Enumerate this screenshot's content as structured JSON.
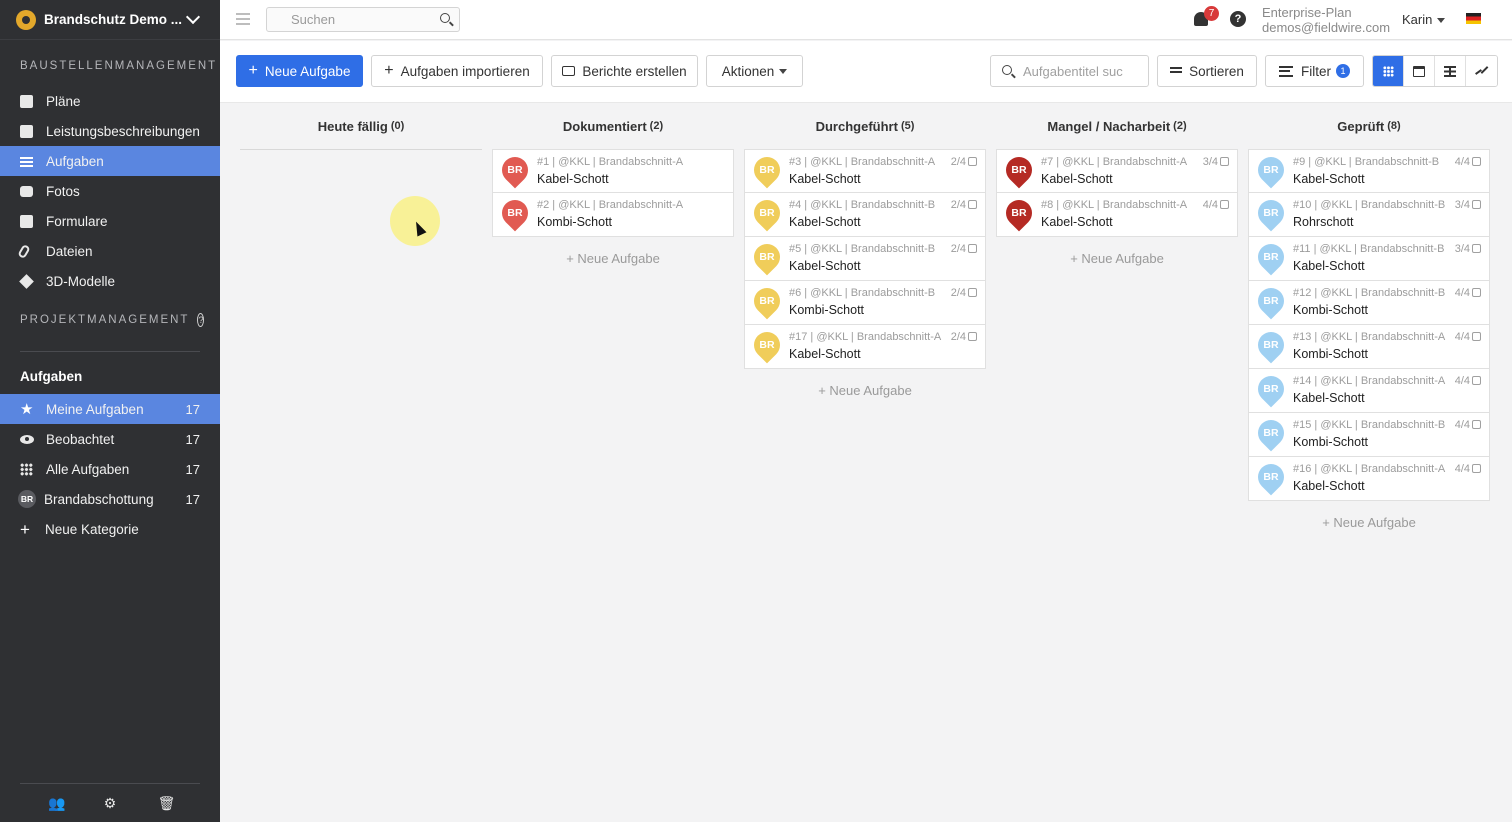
{
  "sidebar": {
    "project_name": "Brandschutz Demo ...",
    "section_site": "BAUSTELLENMANAGEMENT",
    "nav": [
      {
        "label": "Pläne",
        "icon": "plans-icon"
      },
      {
        "label": "Leistungsbeschreibungen",
        "icon": "specs-icon"
      },
      {
        "label": "Aufgaben",
        "icon": "tasks-list-icon",
        "active": true
      },
      {
        "label": "Fotos",
        "icon": "camera-icon"
      },
      {
        "label": "Formulare",
        "icon": "forms-icon"
      },
      {
        "label": "Dateien",
        "icon": "paperclip-icon"
      },
      {
        "label": "3D-Modelle",
        "icon": "cube-icon"
      }
    ],
    "section_project": "PROJEKTMANAGEMENT",
    "categories_title": "Aufgaben",
    "categories": [
      {
        "label": "Meine Aufgaben",
        "count": "17",
        "icon": "star-icon",
        "active": true
      },
      {
        "label": "Beobachtet",
        "count": "17",
        "icon": "eye-icon"
      },
      {
        "label": "Alle Aufgaben",
        "count": "17",
        "icon": "grid-icon"
      },
      {
        "label": "Brandabschottung",
        "count": "17",
        "icon": "category-badge-icon",
        "badge": "BR"
      },
      {
        "label": "Neue Kategorie",
        "count": "",
        "icon": "plus-icon"
      }
    ]
  },
  "topbar": {
    "search_placeholder": "Suchen",
    "notifications": "7",
    "plan": "Enterprise-Plan",
    "email": "demos@fieldwire.com",
    "user": "Karin"
  },
  "toolbar": {
    "new_task": "Neue Aufgabe",
    "import": "Aufgaben importieren",
    "reports": "Berichte erstellen",
    "actions": "Aktionen",
    "task_search_placeholder": "Aufgabentitel suc",
    "sort": "Sortieren",
    "filter": "Filter",
    "filter_count": "1"
  },
  "colors": {
    "accent": "#2f6ee6",
    "red": "#e15a52",
    "dark_red": "#b52a24",
    "yellow": "#f0cd5a",
    "light_blue": "#9fd0f2"
  },
  "board": {
    "new_task_label": "+ Neue Aufgabe",
    "columns": [
      {
        "title": "Heute fällig",
        "count": "(0)",
        "cards": []
      },
      {
        "title": "Dokumentiert",
        "count": "(2)",
        "cards": [
          {
            "meta": "#1 | @KKL | Brandabschnitt-A",
            "title": "Kabel-Schott",
            "check": "",
            "color": "#e15a52",
            "badge": "BR"
          },
          {
            "meta": "#2 | @KKL | Brandabschnitt-A",
            "title": "Kombi-Schott",
            "check": "",
            "color": "#e15a52",
            "badge": "BR"
          }
        ]
      },
      {
        "title": "Durchgeführt",
        "count": "(5)",
        "cards": [
          {
            "meta": "#3 | @KKL | Brandabschnitt-A",
            "title": "Kabel-Schott",
            "check": "2/4",
            "color": "#f0cd5a",
            "badge": "BR"
          },
          {
            "meta": "#4 | @KKL | Brandabschnitt-B",
            "title": "Kabel-Schott",
            "check": "2/4",
            "color": "#f0cd5a",
            "badge": "BR"
          },
          {
            "meta": "#5 | @KKL | Brandabschnitt-B",
            "title": "Kabel-Schott",
            "check": "2/4",
            "color": "#f0cd5a",
            "badge": "BR"
          },
          {
            "meta": "#6 | @KKL | Brandabschnitt-B",
            "title": "Kombi-Schott",
            "check": "2/4",
            "color": "#f0cd5a",
            "badge": "BR"
          },
          {
            "meta": "#17 | @KKL | Brandabschnitt-A",
            "title": "Kabel-Schott",
            "check": "2/4",
            "color": "#f0cd5a",
            "badge": "BR"
          }
        ]
      },
      {
        "title": "Mangel / Nacharbeit",
        "count": "(2)",
        "cards": [
          {
            "meta": "#7 | @KKL | Brandabschnitt-A",
            "title": "Kabel-Schott",
            "check": "3/4",
            "color": "#b52a24",
            "badge": "BR"
          },
          {
            "meta": "#8 | @KKL | Brandabschnitt-A",
            "title": "Kabel-Schott",
            "check": "4/4",
            "color": "#b52a24",
            "badge": "BR"
          }
        ]
      },
      {
        "title": "Geprüft",
        "count": "(8)",
        "cards": [
          {
            "meta": "#9 | @KKL | Brandabschnitt-B",
            "title": "Kabel-Schott",
            "check": "4/4",
            "color": "#9fd0f2",
            "badge": "BR"
          },
          {
            "meta": "#10 | @KKL | Brandabschnitt-B",
            "title": "Rohrschott",
            "check": "3/4",
            "color": "#9fd0f2",
            "badge": "BR"
          },
          {
            "meta": "#11 | @KKL | Brandabschnitt-B",
            "title": "Kabel-Schott",
            "check": "3/4",
            "color": "#9fd0f2",
            "badge": "BR"
          },
          {
            "meta": "#12 | @KKL | Brandabschnitt-B",
            "title": "Kombi-Schott",
            "check": "4/4",
            "color": "#9fd0f2",
            "badge": "BR"
          },
          {
            "meta": "#13 | @KKL | Brandabschnitt-A",
            "title": "Kombi-Schott",
            "check": "4/4",
            "color": "#9fd0f2",
            "badge": "BR"
          },
          {
            "meta": "#14 | @KKL | Brandabschnitt-A",
            "title": "Kabel-Schott",
            "check": "4/4",
            "color": "#9fd0f2",
            "badge": "BR"
          },
          {
            "meta": "#15 | @KKL | Brandabschnitt-B",
            "title": "Kombi-Schott",
            "check": "4/4",
            "color": "#9fd0f2",
            "badge": "BR"
          },
          {
            "meta": "#16 | @KKL | Brandabschnitt-A",
            "title": "Kabel-Schott",
            "check": "4/4",
            "color": "#9fd0f2",
            "badge": "BR"
          }
        ]
      }
    ]
  }
}
